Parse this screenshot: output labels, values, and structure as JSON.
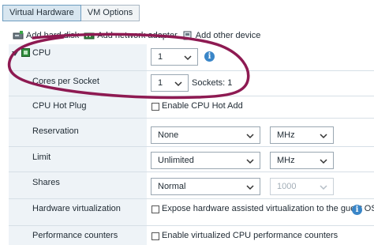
{
  "tabs": [
    {
      "label": "Virtual Hardware",
      "active": true
    },
    {
      "label": "VM Options",
      "active": false
    }
  ],
  "toolbar": {
    "add_hard_disk": "Add hard disk",
    "add_network_adapter": "Add network adapter",
    "add_other_device": "Add other device"
  },
  "cpu": {
    "label": "CPU",
    "value": "1",
    "cores_label": "Cores per Socket",
    "cores_value": "1",
    "sockets_text": "Sockets: 1",
    "hotplug_label": "CPU Hot Plug",
    "hotplug_checkbox": "Enable CPU Hot Add",
    "reservation_label": "Reservation",
    "reservation_value": "None",
    "reservation_unit": "MHz",
    "limit_label": "Limit",
    "limit_value": "Unlimited",
    "limit_unit": "MHz",
    "shares_label": "Shares",
    "shares_value": "Normal",
    "shares_number": "1000",
    "hwvirt_label": "Hardware virtualization",
    "hwvirt_checkbox": "Expose hardware assisted virtualization to the guest OS",
    "perfcounters_label": "Performance counters",
    "perfcounters_checkbox": "Enable virtualized CPU performance counters"
  },
  "colors": {
    "annotation": "#8e1a52",
    "label_bg": "#eef3f7",
    "info_icon": "#3a86c8"
  }
}
